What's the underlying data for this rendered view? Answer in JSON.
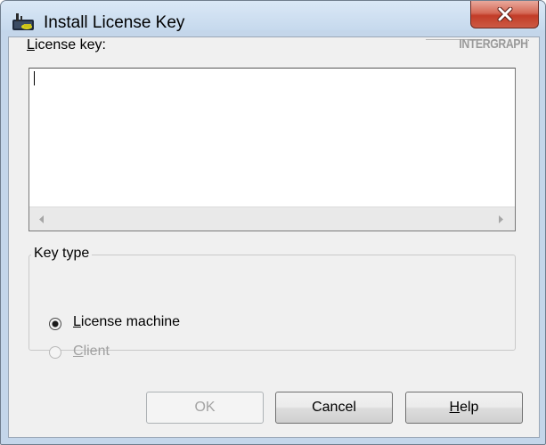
{
  "window": {
    "title": "Install License Key",
    "close_label": "X"
  },
  "logo": {
    "text": "INTERGRAPH"
  },
  "license": {
    "label": "License key:",
    "value": ""
  },
  "key_type": {
    "legend": "Key type",
    "options": [
      {
        "label": "License machine",
        "selected": true,
        "enabled": true
      },
      {
        "label": "Client",
        "selected": false,
        "enabled": false
      }
    ]
  },
  "buttons": {
    "ok": "OK",
    "cancel": "Cancel",
    "help": "Help"
  }
}
